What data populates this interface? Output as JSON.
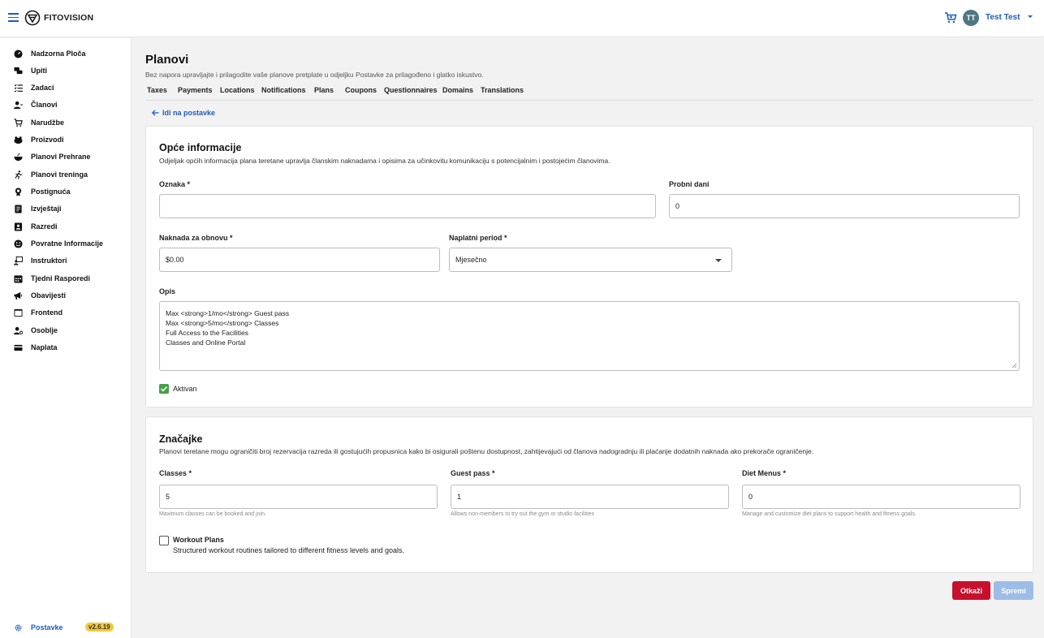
{
  "header": {
    "brand": "FITOVISION",
    "user_initials": "TT",
    "user_name": "Test Test"
  },
  "sidebar": {
    "items": [
      {
        "label": "Nadzorna Ploča",
        "icon": "dashboard-icon"
      },
      {
        "label": "Upiti",
        "icon": "chat-icon"
      },
      {
        "label": "Zadaci",
        "icon": "checklist-icon"
      },
      {
        "label": "Članovi",
        "icon": "members-icon"
      },
      {
        "label": "Narudžbe",
        "icon": "cart-icon"
      },
      {
        "label": "Proizvodi",
        "icon": "products-icon"
      },
      {
        "label": "Planovi Prehrane",
        "icon": "bowl-icon"
      },
      {
        "label": "Planovi treninga",
        "icon": "running-icon"
      },
      {
        "label": "Postignuća",
        "icon": "medal-icon"
      },
      {
        "label": "Izvještaji",
        "icon": "reports-icon"
      },
      {
        "label": "Razredi",
        "icon": "classes-icon"
      },
      {
        "label": "Povratne Informacije",
        "icon": "smiley-icon"
      },
      {
        "label": "Instruktori",
        "icon": "instructor-icon"
      },
      {
        "label": "Tjedni Rasporedi",
        "icon": "calendar-icon"
      },
      {
        "label": "Obavijesti",
        "icon": "megaphone-icon"
      },
      {
        "label": "Frontend",
        "icon": "frontend-icon"
      },
      {
        "label": "Osoblje",
        "icon": "staff-icon"
      },
      {
        "label": "Naplata",
        "icon": "credit-card-icon"
      }
    ],
    "settings_label": "Postavke",
    "version": "v2.6.19"
  },
  "page": {
    "title": "Planovi",
    "subtitle": "Bez napora upravljajte i prilagodite vaše planove pretplate u odjeljku Postavke za prilagođeno i glatko iskustvo.",
    "tabs": [
      "Taxes",
      "Payments",
      "Locations",
      "Notifications",
      "Plans",
      "Coupons",
      "Questionnaires",
      "Domains",
      "Translations"
    ],
    "back_label": "Idi na postavke"
  },
  "general": {
    "title": "Opće informacije",
    "description": "Odjeljak općih informacija plana teretane upravlja članskim naknadama i opisima za učinkovitu komunikaciju s potencijalnim i postojećim članovima.",
    "label_field": {
      "label": "Oznaka *",
      "value": ""
    },
    "trial_days": {
      "label": "Probni dani",
      "value": "0"
    },
    "renewal_fee": {
      "label": "Naknada za obnovu *",
      "value": "$0.00"
    },
    "billing_period": {
      "label": "Naplatni period *",
      "value": "Mjesečno"
    },
    "description_field": {
      "label": "Opis",
      "lines": [
        "Max <strong>1/mo</strong> Guest pass",
        "Max <strong>5/mo</strong> Classes",
        "Full Access to the Facilities",
        "Classes and Online Portal"
      ]
    },
    "active": {
      "label": "Aktivan",
      "checked": true
    }
  },
  "features": {
    "title": "Značajke",
    "description": "Planovi teretane mogu ograničiti broj rezervacija razreda ili gostujućih propusnica kako bi osigurali poštenu dostupnost, zahtijevajući od članova nadogradnju ili plaćanje dodatnih naknada ako prekorače ograničenje.",
    "classes": {
      "label": "Classes *",
      "value": "5",
      "hint": "Maximum classes can be booked and join."
    },
    "guest_pass": {
      "label": "Guest pass *",
      "value": "1",
      "hint": "Allows non-members to try out the gym or studio facilities"
    },
    "diet_menus": {
      "label": "Diet Menus *",
      "value": "0",
      "hint": "Manage and customize diet plans to support health and fitness goals."
    },
    "workout_plans": {
      "label": "Workout Plans",
      "description": "Structured workout routines tailored to different fitness levels and goals.",
      "checked": false
    }
  },
  "actions": {
    "cancel_label": "Otkaži",
    "save_label": "Spremi"
  },
  "colors": {
    "accent": "#1e5bb8",
    "cancel": "#c8102e",
    "save_disabled": "#9dbde6",
    "checkbox_checked": "#43a047",
    "version_badge": "#f3c93b"
  }
}
